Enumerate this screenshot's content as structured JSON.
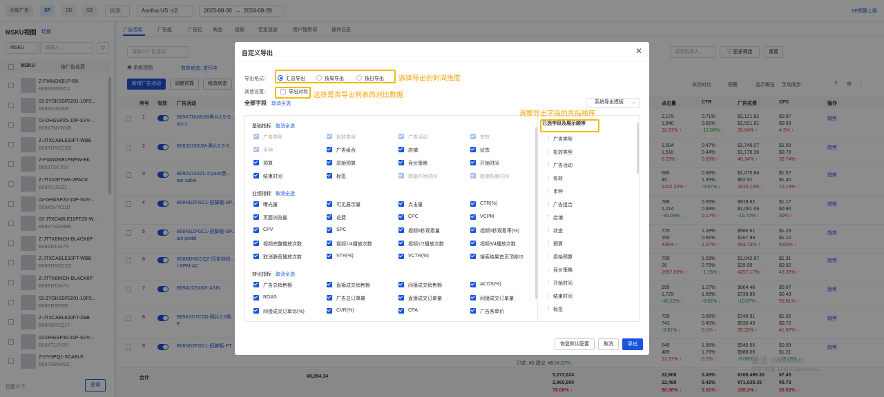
{
  "topbar": {
    "chips": [
      "全部广告",
      "SP",
      "SD",
      "SB"
    ],
    "country": "国家",
    "store": "Asofoo:US",
    "store_more": "+2",
    "date_start": "2023-08-30",
    "date_end": "2024-08-29",
    "right_link": "SP预算上限"
  },
  "left": {
    "title": "MSKU视图",
    "switch": "切换",
    "search_type": "MSKU",
    "search_placeholder": "请输入",
    "col_msku": "MSKU",
    "col_sort": "按广告花费",
    "items": [
      {
        "name": "Z-PIANOKB1P-BK",
        "asin": "B08NSZFGC1"
      },
      {
        "name": "02-ZYSKSSP2201-10P2...",
        "asin": "B08JD19S3M"
      },
      {
        "name": "02-DHGSP25-10P-SVV-...",
        "asin": "B09KTNVWXB"
      },
      {
        "name": "Z-JTXCABLE10FT-WBB",
        "asin": "B08RDRCCQZ"
      },
      {
        "name": "Z-PIANOKB1PNEW-BK",
        "asin": "B093TXK7GY"
      },
      {
        "name": "Z-JTX10FTWK-2PACK",
        "asin": "B092V15SZL"
      },
      {
        "name": "02-DHGSP20-10P-SVV-...",
        "asin": "B09KSV7CDD"
      },
      {
        "name": "02-JTXCABLE10FT2S-W...",
        "asin": "B09H7GZRMB"
      },
      {
        "name": "Z-JTTX6INCH-BLACK6P",
        "asin": "B08RDT347N"
      },
      {
        "name": "Z-JTXCABLE10FT-WBB",
        "asin": "B08RDRCCQZ"
      },
      {
        "name": "Z-JTTX6INCH-BLACK6P",
        "asin": "B08RDT347N"
      },
      {
        "name": "02-ZYSKSSP2201-10P2...",
        "asin": "B08RR925R8"
      },
      {
        "name": "Z-JTXCABLE10FT-ZBB",
        "asin": "B08RDR2Q1Y"
      },
      {
        "name": "02-DHGSP30-10P-SVV-...",
        "asin": "B09KT1XY2R"
      },
      {
        "name": "Z-DYSPQ1-SCABLE",
        "asin": "B097SRM7BZ"
      }
    ],
    "selected": "已选 0 个",
    "query_btn": "查询"
  },
  "main": {
    "tabs": [
      "广告活动",
      "广告组",
      "广告位",
      "商品",
      "投放",
      "否定投放",
      "用户搜索词",
      "操作日志"
    ],
    "filter_placeholder": "请输入广告活动",
    "system_view": "系统视图",
    "status_label": "有效状态: 进行中",
    "new_btn": "新增广告活动",
    "adjust_btn": "调整预算",
    "modify_btn": "修改状态",
    "owner_placeholder": "请选负责人",
    "more_filter": "更多筛选",
    "reset": "重置",
    "toolbar_right": [
      "关闭对比",
      "预警",
      "显示概览",
      "手动同步"
    ],
    "col_seq": "序号",
    "col_valid": "有效",
    "col_name": "广告活动",
    "col_clicks": "点击量",
    "col_ctr": "CTR",
    "col_spend": "广告花费",
    "col_cpc": "CPC",
    "col_op": "操作",
    "rows": [
      {
        "seq": "1",
        "name": "B09KTNVWXB黑片2.5-S...\nact-1"
      },
      {
        "seq": "2",
        "name": "B08JD19SJM-黑片2.5-S..."
      },
      {
        "seq": "3",
        "name": "B092V15SZL-2 pack黑...\nitar cable"
      },
      {
        "seq": "4",
        "name": "B08NSZFGC1-旧脚板-SP..."
      },
      {
        "seq": "5",
        "name": "B08NSZFGC1-旧脚板-SP...\nain pedal"
      },
      {
        "seq": "6",
        "name": "B08RDRCCQZ-旧吉他线...\nt-SPM-AC"
      },
      {
        "seq": "7",
        "name": "B094DC5XKR-ASIN"
      },
      {
        "seq": "8",
        "name": "B09KSV7CDD-两片2.0黑...\nE"
      },
      {
        "seq": "9",
        "name": "B08NSZFGC1-旧脚板-PT..."
      }
    ],
    "total_label": "合计",
    "total_budget": "¥8,894.34",
    "row9_sub": "已花: ¥0   建议: ¥5",
    "metric_rows": [
      {
        "imp": "",
        "clicks": [
          "2,179",
          "1,640",
          "32.87% ↑"
        ],
        "ctr": [
          "0.71%",
          "0.81%",
          "-12.08% ↓"
        ],
        "spend": [
          "$2,121.82",
          "$1,521.81",
          "39.64% ↑"
        ],
        "cpc": [
          "$0.97",
          "$0.93",
          "4.3% ↑"
        ]
      },
      {
        "imp": "",
        "clicks": [
          "1,604",
          "1,510",
          "6.23% ↑"
        ],
        "ctr": [
          "0.47%",
          "0.44%",
          "0.03% ↑"
        ],
        "spend": [
          "$1,745.07",
          "$1,176.36",
          "48.34% ↑"
        ],
        "cpc": [
          "$1.09",
          "$0.78",
          "39.74% ↑"
        ]
      },
      {
        "imp": "",
        "clicks": [
          "685",
          "45",
          "1422.22% ↑"
        ],
        "ctr": [
          "0.68%",
          "1.35%",
          "-0.67% ↓"
        ],
        "spend": [
          "$1,075.84",
          "$62.91",
          "1610.13% ↑"
        ],
        "cpc": [
          "$1.57",
          "$1.40",
          "12.14% ↑"
        ]
      },
      {
        "imp": "",
        "clicks": [
          "788",
          "1,214",
          "-35.09% ↓"
        ],
        "ctr": [
          "0.65%",
          "0.48%",
          "0.17% ↑"
        ],
        "spend": [
          "$919.62",
          "$1,091.09",
          "-15.72% ↓"
        ],
        "cpc": [
          "$1.17",
          "$0.90",
          "30% ↑"
        ]
      },
      {
        "imp": "",
        "clicks": [
          "775",
          "150",
          "430% ↑"
        ],
        "ctr": [
          "1.28%",
          "0.81%",
          "1.07% ↑"
        ],
        "spend": [
          "$980.61",
          "$167.99",
          "483.73% ↑"
        ],
        "cpc": [
          "$1.23",
          "$1.12",
          "9.82% ↑"
        ]
      },
      {
        "imp": "",
        "clicks": [
          "795",
          "26",
          "2957.69% ↑"
        ],
        "ctr": [
          "1.03%",
          "2.79%",
          "-1.75% ↓"
        ],
        "spend": [
          "$1,042.67",
          "$29.95",
          "4257.17% ↑"
        ],
        "cpc": [
          "$1.31",
          "$0.92",
          "42.39% ↑"
        ]
      },
      {
        "imp": "",
        "clicks": [
          "995",
          "1,729",
          "-42.22% ↓"
        ],
        "ctr": [
          "1.27%",
          "1.89%",
          "-0.62% ↓"
        ],
        "spend": [
          "$664.48",
          "$738.85",
          "-10.07% ↓"
        ],
        "cpc": [
          "$0.67",
          "$0.43",
          "55.81% ↑"
        ]
      },
      {
        "imp": "",
        "clicks": [
          "735",
          "741",
          "-0.81% ↓"
        ],
        "ctr": [
          "0.56%",
          "0.45%",
          "0.1% ↑"
        ],
        "spend": [
          "$746.91",
          "$536.49",
          "39.22% ↑"
        ],
        "cpc": [
          "$1.02",
          "$0.72",
          "41.67% ↑"
        ]
      },
      {
        "imp": "",
        "clicks": [
          "545",
          "485",
          "12.37% ↑"
        ],
        "ctr": [
          "1.96%",
          "1.76%",
          "0.2% ↑"
        ],
        "spend": [
          "$540.55",
          "$588.05",
          "-8.08% ↓"
        ],
        "cpc": [
          "$0.99",
          "$1.21",
          "-18.18% ↓"
        ]
      }
    ],
    "total": {
      "imp": [
        "5,272,824",
        "2,960,900",
        "78.08% ↑"
      ],
      "clicks": [
        "22,608",
        "12,499",
        "80.88% ↑"
      ],
      "ctr": [
        "0.43%",
        "0.42%",
        "0.01% ↑"
      ],
      "spend": [
        "¥168,496.33",
        "¥71,638.35",
        "135.2% ↑"
      ],
      "cpc": [
        "¥7.45",
        "¥5.73",
        "30.02% ↑"
      ]
    },
    "row9_imp": "-24.87% ↓",
    "row9_clicks": "-16.15% ↓",
    "op_link": "趋势",
    "watermark1": "激活 Windows",
    "watermark2": "转到\"设置\"以激活 Windows。"
  },
  "modal": {
    "title": "自定义导出",
    "format_label": "导出格式：",
    "format_options": [
      "汇总导出",
      "按周导出",
      "按日导出"
    ],
    "other_label": "其他设置：",
    "compare_label": "导出对比",
    "all_fields": "全部字段",
    "cancel_all": "取消全选",
    "template_select": "系统导出模板",
    "sections": [
      {
        "title": "基础指标",
        "link": "取消全选",
        "fields": [
          {
            "l": "广告类型",
            "d": true
          },
          {
            "l": "投放类型",
            "d": true
          },
          {
            "l": "广告活动",
            "d": true
          },
          {
            "l": "有效",
            "d": true
          },
          {
            "l": "币种",
            "d": true
          },
          {
            "l": "广告组合",
            "d": false
          },
          {
            "l": "店铺",
            "d": false
          },
          {
            "l": "状态",
            "d": false
          },
          {
            "l": "预算",
            "d": false
          },
          {
            "l": "原始预算",
            "d": false
          },
          {
            "l": "竞价策略",
            "d": false
          },
          {
            "l": "开始时间",
            "d": false
          },
          {
            "l": "结束时间",
            "d": false
          },
          {
            "l": "标签",
            "d": false
          },
          {
            "l": "数据开始时间",
            "d": true
          },
          {
            "l": "数据结束时间",
            "d": true
          }
        ]
      },
      {
        "title": "业绩指标",
        "link": "取消全选",
        "fields": [
          {
            "l": "曝光量",
            "d": false
          },
          {
            "l": "可见展示量",
            "d": false
          },
          {
            "l": "点击量",
            "d": false
          },
          {
            "l": "CTR(%)",
            "d": false
          },
          {
            "l": "页面浏览量",
            "d": false
          },
          {
            "l": "花费",
            "d": false
          },
          {
            "l": "CPC",
            "d": false
          },
          {
            "l": "VCPM",
            "d": false
          },
          {
            "l": "CPV",
            "d": false
          },
          {
            "l": "SPC",
            "d": false
          },
          {
            "l": "视频5秒观看量",
            "d": false
          },
          {
            "l": "视频5秒观看率(%)",
            "d": false
          },
          {
            "l": "视频完整播放次数",
            "d": false
          },
          {
            "l": "视频1/4播放次数",
            "d": false
          },
          {
            "l": "视频1/2播放次数",
            "d": false
          },
          {
            "l": "视频3/4播放次数",
            "d": false
          },
          {
            "l": "取消静音播放次数",
            "d": false
          },
          {
            "l": "VTR(%)",
            "d": false
          },
          {
            "l": "VCTR(%)",
            "d": false
          },
          {
            "l": "搜索结果首页顶部IS",
            "d": false
          }
        ]
      },
      {
        "title": "转化指标",
        "link": "取消全选",
        "fields": [
          {
            "l": "广告总销售额",
            "d": false
          },
          {
            "l": "直接成交销售额",
            "d": false
          },
          {
            "l": "间接成交销售额",
            "d": false
          },
          {
            "l": "ACOS(%)",
            "d": false
          },
          {
            "l": "ROAS",
            "d": false
          },
          {
            "l": "广告总订单量",
            "d": false
          },
          {
            "l": "直接成交订单量",
            "d": false
          },
          {
            "l": "间接成交订单量",
            "d": false
          },
          {
            "l": "间接成交订单比(%)",
            "d": false
          },
          {
            "l": "CVR(%)",
            "d": false
          },
          {
            "l": "CPA",
            "d": false
          },
          {
            "l": "广告客单价",
            "d": false
          }
        ]
      }
    ],
    "selected_title": "已选字段及展示顺序",
    "selected_items": [
      "广告类型",
      "投放类型",
      "广告活动",
      "有效",
      "币种",
      "广告组合",
      "店铺",
      "状态",
      "预算",
      "原始预算",
      "竞价策略",
      "开始时间",
      "结束时间",
      "标签"
    ],
    "reset_btn": "恢复默认配置",
    "cancel_btn": "取消",
    "export_btn": "导出"
  },
  "annotations": {
    "a1": "选择导出的时间维度",
    "a2": "选择是否导出列表的对比数据",
    "a3": "调整导出字段的先后顺序",
    "color": "#f5b914"
  },
  "colors": {
    "accent": "#1a56db",
    "up": "#e03131",
    "down": "#1f9d3a"
  }
}
